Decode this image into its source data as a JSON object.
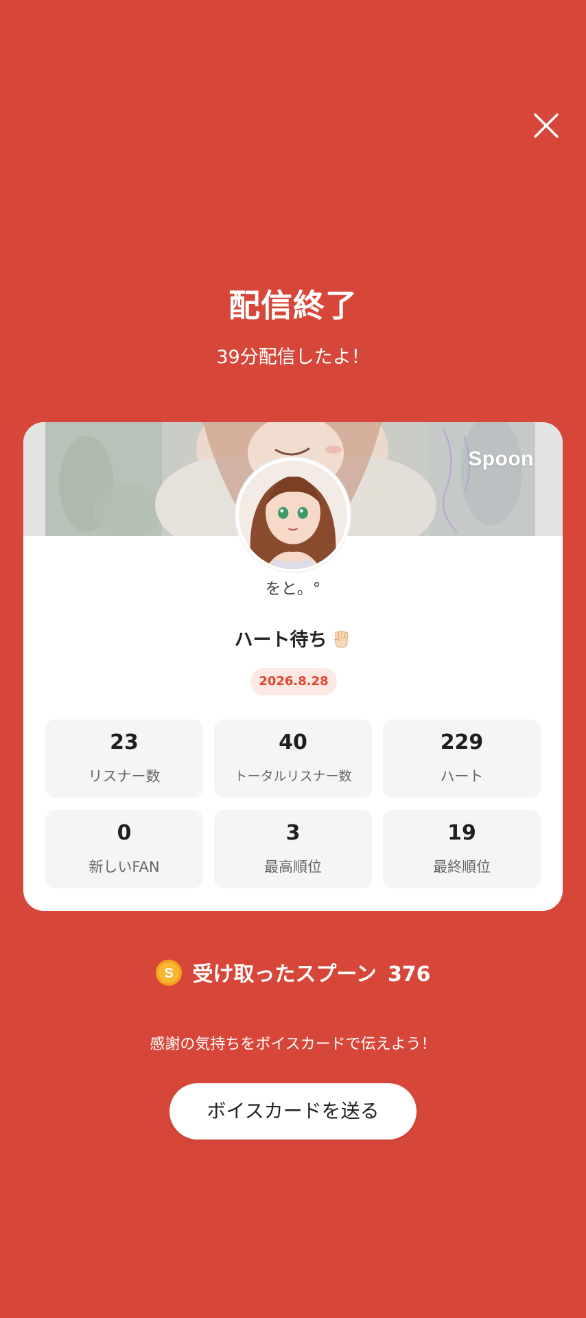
{
  "colors": {
    "background": "#d74739",
    "card": "#ffffff",
    "accent": "#e2452d",
    "tile": "#f5f5f5"
  },
  "icons": {
    "close": "close-icon",
    "fist": "raised-fist-emoji-icon",
    "coin": "spoon-coin-icon"
  },
  "header": {
    "title": "配信終了",
    "subtitle": "39分配信したよ！"
  },
  "card": {
    "brand": "Spoon",
    "username": "をと。°",
    "broadcast_title": "ハート待ち",
    "date": "2026.8.28",
    "stats": [
      {
        "value": "23",
        "label": "リスナー数"
      },
      {
        "value": "40",
        "label": "トータルリスナー数"
      },
      {
        "value": "229",
        "label": "ハート"
      },
      {
        "value": "0",
        "label": "新しいFAN"
      },
      {
        "value": "3",
        "label": "最高順位"
      },
      {
        "value": "19",
        "label": "最終順位"
      }
    ]
  },
  "spoons": {
    "label": "受け取ったスプーン",
    "count": "376"
  },
  "footer": {
    "message": "感謝の気持ちをボイスカードで伝えよう！",
    "button_label": "ボイスカードを送る"
  }
}
